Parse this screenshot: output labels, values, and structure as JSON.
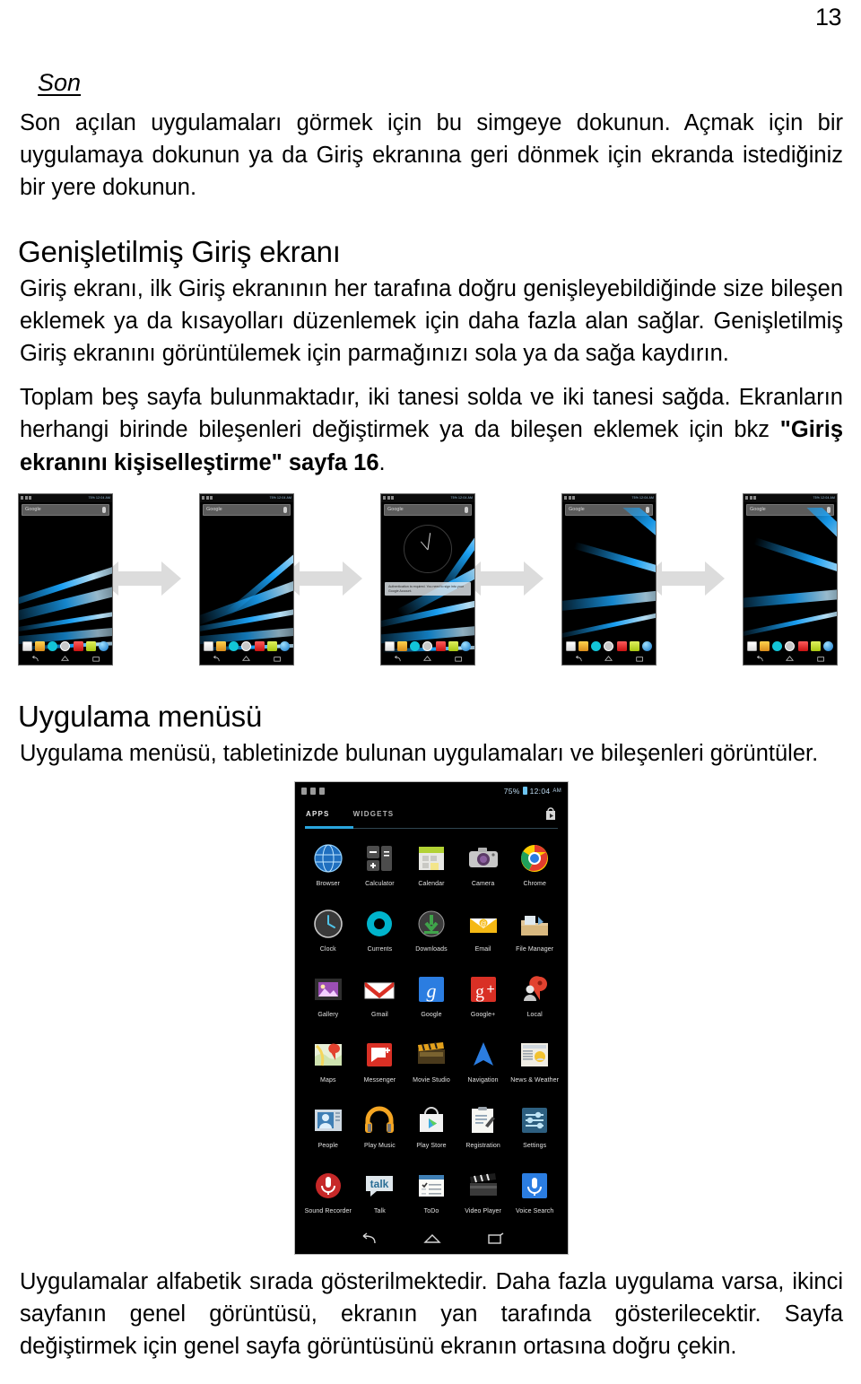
{
  "page": {
    "number": "13"
  },
  "sections": [
    {
      "heading": "Son",
      "paragraphs": [
        "Son açılan uygulamaları görmek için bu simgeye dokunun. Açmak için bir uygulamaya dokunun ya da Giriş ekranına geri dönmek için ekranda istediğiniz bir yere dokunun."
      ]
    }
  ],
  "expanded_home": {
    "heading": "Genişletilmiş Giriş ekranı",
    "paragraph1": "Giriş ekranı, ilk Giriş ekranının her tarafına doğru genişleyebildiğinde size bileşen eklemek ya da kısayolları düzenlemek için daha fazla alan sağlar. Genişletilmiş Giriş ekranını görüntülemek için parmağınızı sola ya da sağa kaydırın.",
    "paragraph2_a": "Toplam beş sayfa bulunmaktadır, iki tanesi solda ve iki tanesi sağda. Ekranların herhangi birinde bileşenleri değiştirmek ya da bileşen eklemek için bkz ",
    "paragraph2_bold": "\"Giriş ekranını kişiselleştirme\" sayfa 16",
    "paragraph2_c": "."
  },
  "app_menu": {
    "heading": "Uygulama menüsü",
    "paragraph": "Uygulama menüsü, tabletinizde bulunan uygulamaları ve bileşenleri görüntüler.",
    "footer_paragraph": "Uygulamalar alfabetik sırada gösterilmektedir. Daha fazla uygulama varsa, ikinci sayfanın genel görüntüsü, ekranın yan tarafında gösterilecektir. Sayfa değiştirmek için genel sayfa görüntüsünü ekranın ortasına doğru çekin."
  },
  "home_thumbnails": {
    "search_placeholder": "Google",
    "status_right": "75% 12:04 AM",
    "notification_text": "Authentication is required. You need to sign into your Google Account.",
    "screens": [
      {
        "name": "home-screen-1",
        "has_clock": false,
        "has_notification": false
      },
      {
        "name": "home-screen-2",
        "has_clock": false,
        "has_notification": false
      },
      {
        "name": "home-screen-3",
        "has_clock": true,
        "has_notification": true
      },
      {
        "name": "home-screen-4",
        "has_clock": false,
        "has_notification": false
      },
      {
        "name": "home-screen-5",
        "has_clock": false,
        "has_notification": false
      }
    ],
    "arrow_count": 4,
    "arrow_color": "#dcdcdc"
  },
  "drawer": {
    "status_battery_percent": "75%",
    "status_time": "12:04",
    "status_ampm": "AM",
    "tab_apps": "APPS",
    "tab_widgets": "WIDGETS",
    "accent_color": "#2aa5dd",
    "apps": [
      {
        "label": "Browser",
        "icon": "browser-icon"
      },
      {
        "label": "Calculator",
        "icon": "calculator-icon"
      },
      {
        "label": "Calendar",
        "icon": "calendar-icon"
      },
      {
        "label": "Camera",
        "icon": "camera-icon"
      },
      {
        "label": "Chrome",
        "icon": "chrome-icon"
      },
      {
        "label": "Clock",
        "icon": "clock-icon"
      },
      {
        "label": "Currents",
        "icon": "currents-icon"
      },
      {
        "label": "Downloads",
        "icon": "downloads-icon"
      },
      {
        "label": "Email",
        "icon": "email-icon"
      },
      {
        "label": "File Manager",
        "icon": "file-manager-icon"
      },
      {
        "label": "Gallery",
        "icon": "gallery-icon"
      },
      {
        "label": "Gmail",
        "icon": "gmail-icon"
      },
      {
        "label": "Google",
        "icon": "google-icon"
      },
      {
        "label": "Google+",
        "icon": "google-plus-icon"
      },
      {
        "label": "Local",
        "icon": "local-icon"
      },
      {
        "label": "Maps",
        "icon": "maps-icon"
      },
      {
        "label": "Messenger",
        "icon": "messenger-icon"
      },
      {
        "label": "Movie Studio",
        "icon": "movie-studio-icon"
      },
      {
        "label": "Navigation",
        "icon": "navigation-icon"
      },
      {
        "label": "News & Weather",
        "icon": "news-weather-icon"
      },
      {
        "label": "People",
        "icon": "people-icon"
      },
      {
        "label": "Play Music",
        "icon": "play-music-icon"
      },
      {
        "label": "Play Store",
        "icon": "play-store-icon"
      },
      {
        "label": "Registration",
        "icon": "registration-icon"
      },
      {
        "label": "Settings",
        "icon": "settings-icon"
      },
      {
        "label": "Sound Recorder",
        "icon": "sound-recorder-icon"
      },
      {
        "label": "Talk",
        "icon": "talk-icon"
      },
      {
        "label": "ToDo",
        "icon": "todo-icon"
      },
      {
        "label": "Video Player",
        "icon": "video-player-icon"
      },
      {
        "label": "Voice Search",
        "icon": "voice-search-icon"
      }
    ],
    "nav_buttons": [
      "back-icon",
      "home-icon",
      "recents-icon"
    ]
  }
}
